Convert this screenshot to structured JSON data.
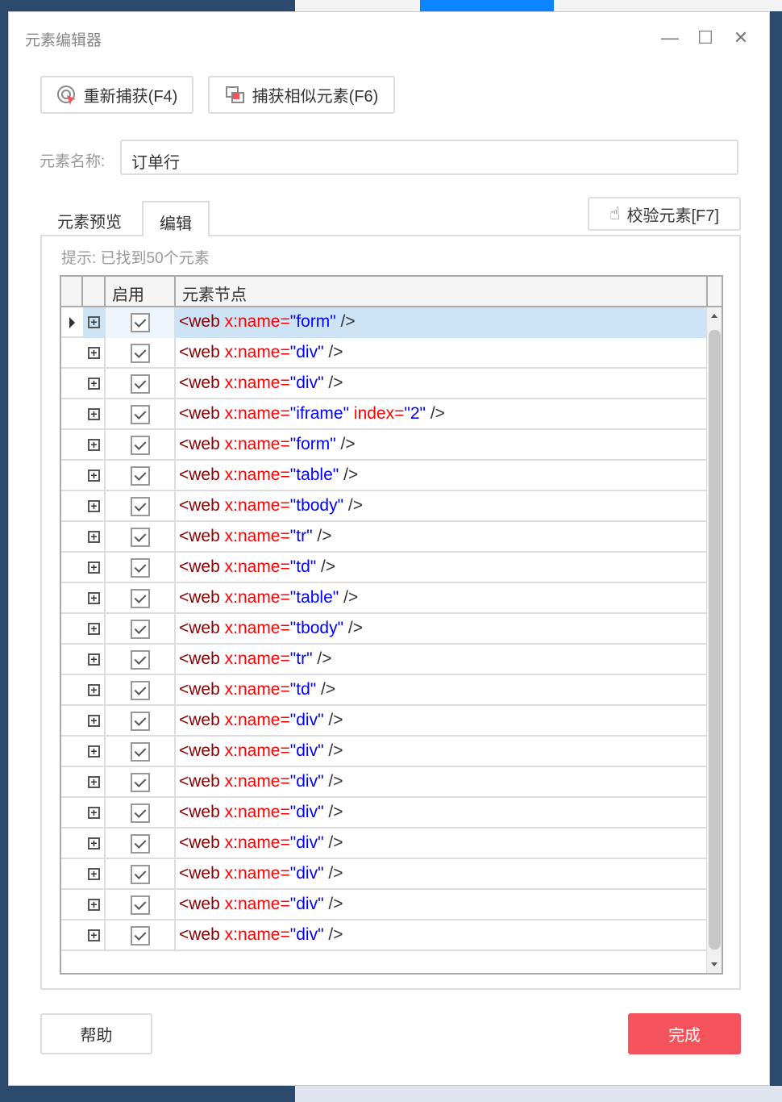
{
  "window": {
    "title": "元素编辑器",
    "minimize": "—",
    "maximize": "☐",
    "close": "✕"
  },
  "toolbar": {
    "recapture": "重新捕获(F4)",
    "capture_similar": "捕获相似元素(F6)"
  },
  "name_field": {
    "label": "元素名称:",
    "value": "订单行"
  },
  "tabs": [
    {
      "label": "元素预览",
      "active": false
    },
    {
      "label": "编辑",
      "active": true
    }
  ],
  "validate_button": "校验元素[F7]",
  "hint": "提示: 已找到50个元素",
  "grid": {
    "columns": [
      "启用",
      "元素节点"
    ],
    "rows": [
      {
        "value": "form",
        "checked": true,
        "selected": true
      },
      {
        "value": "div",
        "checked": true
      },
      {
        "value": "div",
        "checked": true
      },
      {
        "value": "iframe",
        "checked": true,
        "extra_attr": "index",
        "extra_value": "2"
      },
      {
        "value": "form",
        "checked": true
      },
      {
        "value": "table",
        "checked": true
      },
      {
        "value": "tbody",
        "checked": true
      },
      {
        "value": "tr",
        "checked": true
      },
      {
        "value": "td",
        "checked": true
      },
      {
        "value": "table",
        "checked": true
      },
      {
        "value": "tbody",
        "checked": true
      },
      {
        "value": "tr",
        "checked": true
      },
      {
        "value": "td",
        "checked": true
      },
      {
        "value": "div",
        "checked": true
      },
      {
        "value": "div",
        "checked": true
      },
      {
        "value": "div",
        "checked": true
      },
      {
        "value": "div",
        "checked": true
      },
      {
        "value": "div",
        "checked": true
      },
      {
        "value": "div",
        "checked": true
      },
      {
        "value": "div",
        "checked": true
      },
      {
        "value": "div",
        "checked": true
      }
    ]
  },
  "footer": {
    "help": "帮助",
    "done": "完成"
  },
  "colors": {
    "accent": "#f5535b",
    "selected_row": "#cde4f7",
    "tag": "#8b0000",
    "attr": "#ff0000",
    "value": "#0000ff"
  }
}
